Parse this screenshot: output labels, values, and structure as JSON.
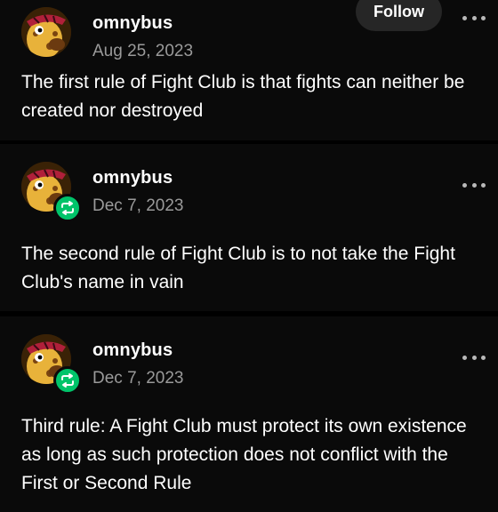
{
  "posts": [
    {
      "username": "omnybus",
      "date": "Aug 25, 2023",
      "follow_label": "Follow",
      "text": "The first rule of Fight Club is that fights can neither be created nor destroyed",
      "reblogged": false
    },
    {
      "username": "omnybus",
      "date": "Dec 7, 2023",
      "text": "The second rule of Fight Club is to not take the Fight Club's name in vain",
      "reblogged": true
    },
    {
      "username": "omnybus",
      "date": "Dec 7, 2023",
      "text": "Third rule: A Fight Club must protect its own existence as long as such protection does not conflict with the First or Second Rule",
      "reblogged": true
    }
  ],
  "colors": {
    "background": "#000000",
    "card": "#0a0a0a",
    "date_text": "#9a9a9a",
    "follow_bg": "#262626",
    "reblog_green": "#00c46a"
  },
  "icons": {
    "avatar": "giraffe-avatar-icon",
    "reblog": "reblog-icon",
    "more": "more-options-icon"
  }
}
